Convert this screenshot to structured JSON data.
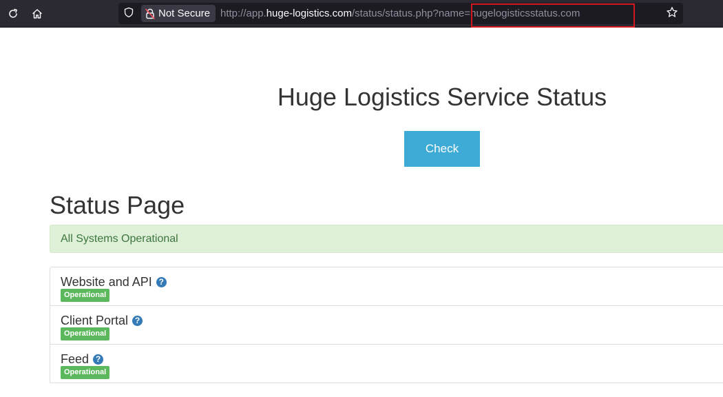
{
  "browser": {
    "security_label": "Not Secure",
    "url": {
      "prefix": "http://app.",
      "host": "huge-logistics.com",
      "path": "/status/status.php?name=hugelogisticsstatus.com"
    }
  },
  "page": {
    "title": "Huge Logistics Service Status",
    "check_label": "Check",
    "status_heading": "Status Page",
    "alert": "All Systems Operational",
    "help_glyph": "?",
    "services": [
      {
        "name": "Website and API",
        "status": "Operational"
      },
      {
        "name": "Client Portal",
        "status": "Operational"
      },
      {
        "name": "Feed",
        "status": "Operational"
      }
    ]
  },
  "colors": {
    "accent_button": "#3eaad6",
    "success_badge": "#5cb85c",
    "alert_background": "#dff0d8",
    "highlight_box": "#d3181f"
  }
}
